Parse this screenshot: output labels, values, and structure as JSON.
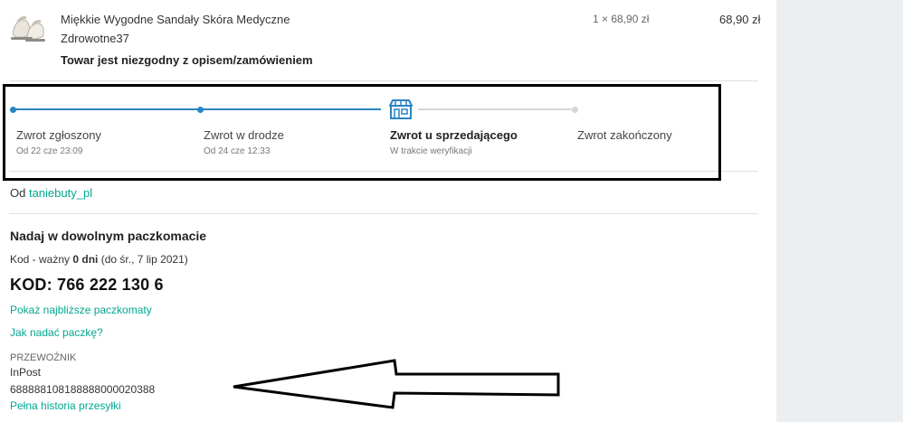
{
  "product": {
    "name": "Miękkie Wygodne Sandały Skóra Medyczne",
    "seller_code": "Zdrowotne37",
    "reason": "Towar jest niezgodny z opisem/zamówieniem",
    "quantity_price": "1 × 68,90 zł",
    "total": "68,90 zł"
  },
  "return_steps": [
    {
      "label": "Zwrot zgłoszony",
      "sub": "Od 22 cze 23:09",
      "state": "done"
    },
    {
      "label": "Zwrot w drodze",
      "sub": "Od 24 cze 12:33",
      "state": "done"
    },
    {
      "label": "Zwrot u sprzedającego",
      "sub": "W trakcie weryfikacji",
      "state": "active",
      "icon": "store-icon"
    },
    {
      "label": "Zwrot zakończony",
      "sub": "",
      "state": "pending"
    }
  ],
  "from": {
    "prefix": "Od",
    "seller": "taniebuty_pl"
  },
  "parcel": {
    "title": "Nadaj w dowolnym paczkomacie",
    "code_prefix": "Kod - ważny ",
    "code_validity_bold": "0 dni",
    "code_validity_rest": " (do śr., 7 lip 2021)",
    "code": "KOD: 766 222 130 6",
    "link_lockers": "Pokaż najbliższe paczkomaty",
    "link_howto": "Jak nadać paczkę?"
  },
  "carrier": {
    "label": "PRZEWOŹNIK",
    "name": "InPost",
    "tracking": "688888108188888000020388",
    "history_link": "Pełna historia przesyłki"
  },
  "colors": {
    "accent": "#2a84c5",
    "link": "#00a790",
    "panel": "#eceff1"
  }
}
